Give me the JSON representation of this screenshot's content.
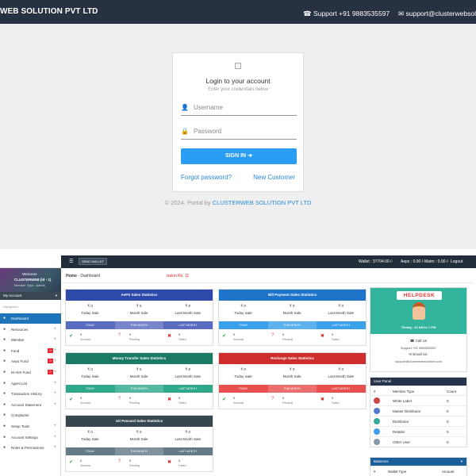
{
  "topbar": {
    "brand": "WEB SOLUTION PVT LTD",
    "support_phone": "Support +91 9883535597",
    "support_email": "support@clusterwebsol"
  },
  "login": {
    "title": "Login to your account",
    "subtitle": "Enter your credentials below",
    "username_placeholder": "Username",
    "password_placeholder": "Password",
    "signin_label": "SIGN IN",
    "forgot_link": "Forgot password?",
    "new_customer_link": "New Customer",
    "footer_prefix": "© 2024. Portal by ",
    "footer_company": "CLUSTERWEB SOLUTION PVT LTD"
  },
  "dash": {
    "nav": {
      "send_wallet": "SEND WALLET",
      "wallet": "Wallet : 37704.00 /-",
      "aeps": "Aeps : 0.00 /-",
      "matm": "Matm : 0.00 /-",
      "logout": "Logout"
    },
    "profile": {
      "welcome": "Welcome",
      "name": "CLUSTERWEB (id - 1)",
      "member_type": "Member Type : Admin"
    },
    "sidebar": {
      "my_account": "My Account",
      "navigation": "Navigation",
      "items": [
        {
          "label": "Dashboard",
          "icon": "home-icon",
          "active": true,
          "plus": ""
        },
        {
          "label": "Resources",
          "icon": "gear-icon",
          "plus": "+"
        },
        {
          "label": "Member",
          "icon": "user-icon",
          "plus": "+"
        },
        {
          "label": "Fund",
          "icon": "wallet-icon",
          "plus": "+",
          "badge": "0"
        },
        {
          "label": "Aeps Fund",
          "icon": "wallet-icon",
          "plus": "+",
          "badge": "0"
        },
        {
          "label": "M-Atm Fund",
          "icon": "wallet-icon",
          "plus": "+",
          "badge": "0"
        },
        {
          "label": "Agent List",
          "icon": "list-icon",
          "plus": "+"
        },
        {
          "label": "Transaction History",
          "icon": "history-icon",
          "plus": "+"
        },
        {
          "label": "Account Statement",
          "icon": "statement-icon",
          "plus": "+"
        },
        {
          "label": "Complaints",
          "icon": "complaint-icon",
          "plus": ""
        },
        {
          "label": "Setup Tools",
          "icon": "tools-icon",
          "plus": "+"
        },
        {
          "label": "Account Settings",
          "icon": "settings-icon",
          "plus": "+"
        },
        {
          "label": "Roles & Permissions",
          "icon": "lock-icon",
          "plus": "+"
        }
      ]
    },
    "breadcrumb": {
      "home": "Home",
      "sep": " - ",
      "current": "Dashboard",
      "session": "ission Rs. 11"
    },
    "stat_labels": {
      "today_sale": "Today Sale",
      "month_sale": "Month Sale",
      "last_month_sale": "Last Month Sale",
      "today": "TODAY",
      "this_month": "THIS MONTH",
      "last_month": "LAST MONTH",
      "success": "Success",
      "pending": "Pending",
      "failed": "Failed",
      "amount": "₹ 0",
      "count": "0"
    },
    "stats": [
      {
        "title": "AePS Sales Statistics",
        "color": "#2d4aa8",
        "bar": "#5a6cc0"
      },
      {
        "title": "Bill Payment Sales Statistics",
        "color": "#1e74c8",
        "bar": "#3aa0ea"
      },
      {
        "title": "Money Transfer Sales Statistics",
        "color": "#1b7a64",
        "bar": "#2fa88a"
      },
      {
        "title": "Recharge Sales Statistics",
        "color": "#cf2d2d",
        "bar": "#e85050"
      },
      {
        "title": "Uti Pancard Sales Statistics",
        "color": "#37474f",
        "bar": "#647a86"
      }
    ],
    "helpdesk": {
      "logo": "HELPDESK",
      "timing": "Timing - 10 AM to 7 PM",
      "call_us": "Call Us",
      "phone": "Support +91 9883535597",
      "email_us": "Email Us:",
      "email": "support@clusterwebsolution.com"
    },
    "user_panel": {
      "title": "User Panel",
      "col_num": "#",
      "col_type": "Member Type",
      "col_count": "Count",
      "rows": [
        {
          "type": "White Label",
          "count": "0"
        },
        {
          "type": "Master Distributor",
          "count": "0"
        },
        {
          "type": "Distributor",
          "count": "0"
        },
        {
          "type": "Retailer",
          "count": "3"
        },
        {
          "type": "Other User",
          "count": "0"
        }
      ]
    },
    "balances": {
      "title": "Balances",
      "col_num": "#",
      "col_type": "Wallet Type",
      "col_amount": "Amount"
    }
  }
}
